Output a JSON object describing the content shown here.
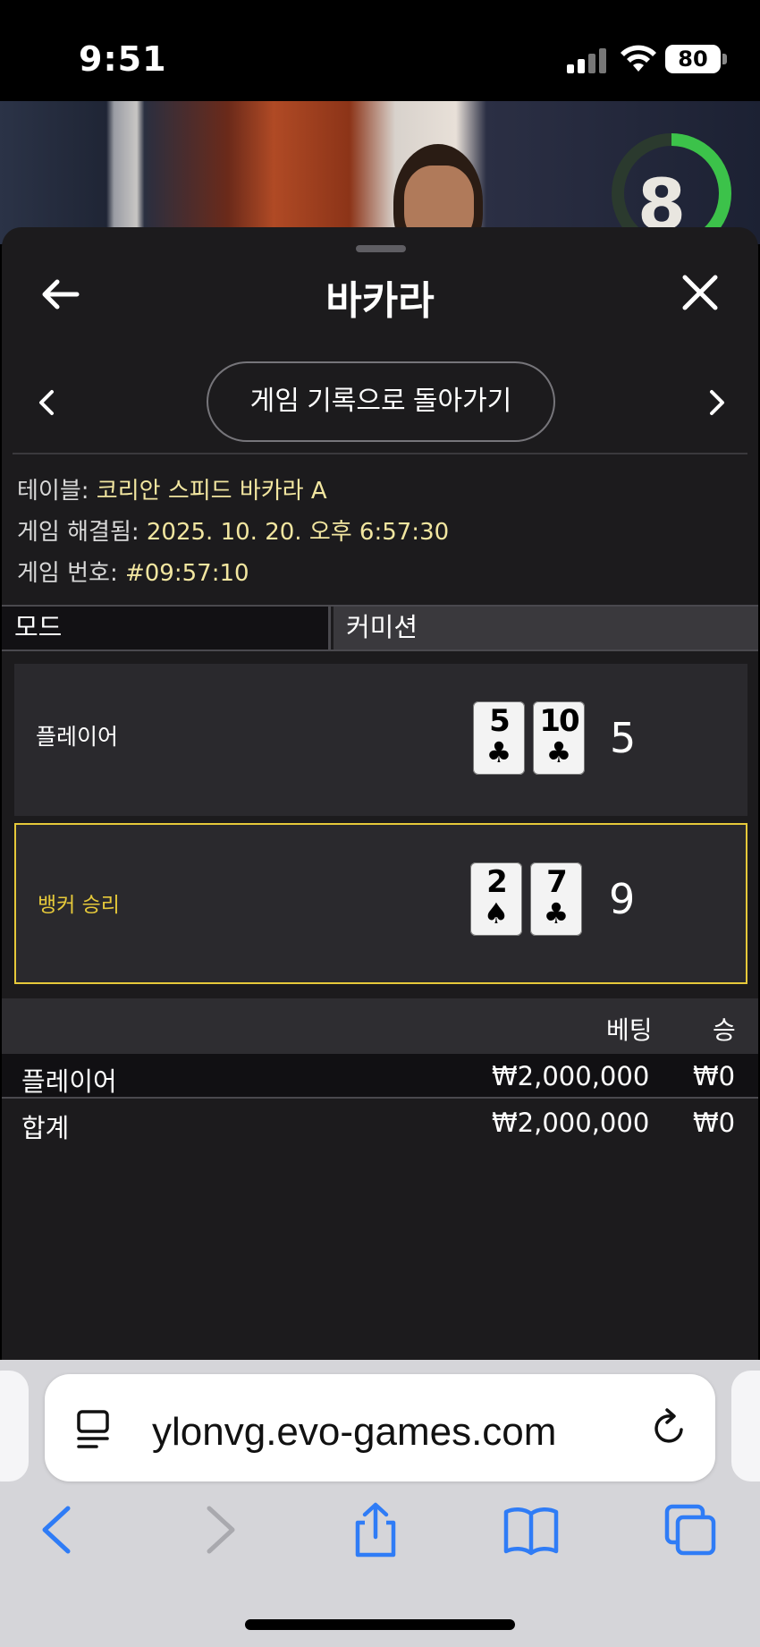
{
  "status_bar": {
    "time": "9:51",
    "battery": "80"
  },
  "video": {
    "timer": "8"
  },
  "header": {
    "title": "바카라"
  },
  "history_nav": {
    "back_to_history_label": "게임 기록으로 돌아가기"
  },
  "game_info": {
    "table_label": "테이블:",
    "table_value": "코리안 스피드 바카라 A",
    "resolved_label": "게임 해결됨:",
    "resolved_value": "2025. 10. 20. 오후 6:57:30",
    "game_no_label": "게임 번호:",
    "game_no_value": "#09:57:10"
  },
  "mode": {
    "label": "모드",
    "value": "커미션"
  },
  "hands": {
    "player": {
      "label": "플레이어",
      "cards": [
        {
          "rank": "5",
          "suit": "♣"
        },
        {
          "rank": "10",
          "suit": "♣"
        }
      ],
      "score": "5"
    },
    "banker": {
      "label": "뱅커 승리",
      "cards": [
        {
          "rank": "2",
          "suit": "♠"
        },
        {
          "rank": "7",
          "suit": "♣"
        }
      ],
      "score": "9"
    }
  },
  "bets": {
    "headers": {
      "bet": "베팅",
      "win": "승"
    },
    "rows": [
      {
        "name": "플레이어",
        "bet": "₩2,000,000",
        "win": "₩0"
      },
      {
        "name": "합계",
        "bet": "₩2,000,000",
        "win": "₩0"
      }
    ]
  },
  "browser": {
    "url": "ylonvg.evo-games.com"
  },
  "colors": {
    "highlight_gold": "#e6c93a",
    "info_value": "#f2e6a0",
    "ios_blue": "#2f7cf6"
  }
}
